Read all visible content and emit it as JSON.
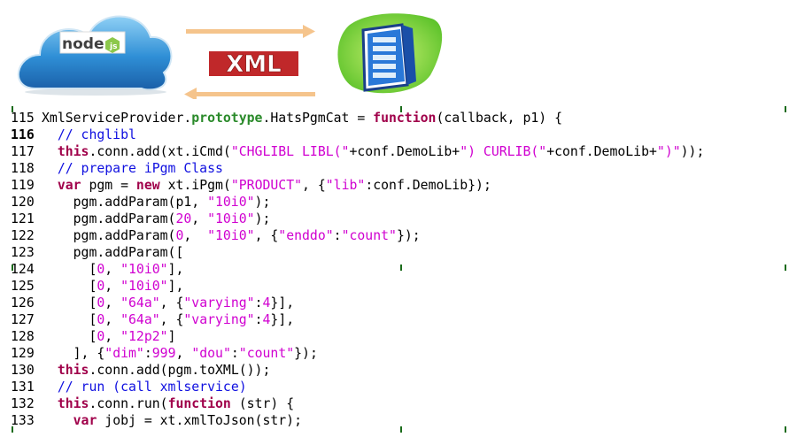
{
  "diagram": {
    "node_logo_text": "node",
    "xml_label": "XML"
  },
  "colors": {
    "keyword": "#a0004a",
    "property": "#2a8a2a",
    "string": "#d000d0",
    "comment": "#1010e0",
    "cloud": "#3a9ad8",
    "server_bg": "#7ad23a",
    "arrow": "#f5c48c",
    "xml_box": "#c0282a"
  },
  "code": {
    "lines": [
      {
        "num": "115",
        "bold": false,
        "tokens": [
          [
            "plain",
            "XmlServiceProvider."
          ],
          [
            "prop",
            "prototype"
          ],
          [
            "plain",
            ".HatsPgmCat = "
          ],
          [
            "kw",
            "function"
          ],
          [
            "plain",
            "(callback, p1) {"
          ]
        ]
      },
      {
        "num": "116",
        "bold": true,
        "tokens": [
          [
            "plain",
            "  "
          ],
          [
            "com",
            "// chglibl"
          ]
        ]
      },
      {
        "num": "117",
        "bold": false,
        "tokens": [
          [
            "plain",
            "  "
          ],
          [
            "kw",
            "this"
          ],
          [
            "plain",
            ".conn.add(xt.iCmd("
          ],
          [
            "str",
            "\"CHGLIBL LIBL(\""
          ],
          [
            "plain",
            "+conf.DemoLib+"
          ],
          [
            "str",
            "\") CURLIB(\""
          ],
          [
            "plain",
            "+conf.DemoLib+"
          ],
          [
            "str",
            "\")\""
          ],
          [
            "plain",
            "));"
          ]
        ]
      },
      {
        "num": "118",
        "bold": false,
        "tokens": [
          [
            "plain",
            "  "
          ],
          [
            "com",
            "// prepare iPgm Class"
          ]
        ]
      },
      {
        "num": "119",
        "bold": false,
        "tokens": [
          [
            "plain",
            "  "
          ],
          [
            "kw",
            "var"
          ],
          [
            "plain",
            " pgm = "
          ],
          [
            "kw",
            "new"
          ],
          [
            "plain",
            " xt.iPgm("
          ],
          [
            "str",
            "\"PRODUCT\""
          ],
          [
            "plain",
            ", {"
          ],
          [
            "str",
            "\"lib\""
          ],
          [
            "plain",
            ":conf.DemoLib});"
          ]
        ]
      },
      {
        "num": "120",
        "bold": false,
        "tokens": [
          [
            "plain",
            "    pgm.addParam(p1, "
          ],
          [
            "str",
            "\"10i0\""
          ],
          [
            "plain",
            ");"
          ]
        ]
      },
      {
        "num": "121",
        "bold": false,
        "tokens": [
          [
            "plain",
            "    pgm.addParam("
          ],
          [
            "num",
            "20"
          ],
          [
            "plain",
            ", "
          ],
          [
            "str",
            "\"10i0\""
          ],
          [
            "plain",
            ");"
          ]
        ]
      },
      {
        "num": "122",
        "bold": false,
        "tokens": [
          [
            "plain",
            "    pgm.addParam("
          ],
          [
            "num",
            "0"
          ],
          [
            "plain",
            ",  "
          ],
          [
            "str",
            "\"10i0\""
          ],
          [
            "plain",
            ", {"
          ],
          [
            "str",
            "\"enddo\""
          ],
          [
            "plain",
            ":"
          ],
          [
            "str",
            "\"count\""
          ],
          [
            "plain",
            "});"
          ]
        ]
      },
      {
        "num": "123",
        "bold": false,
        "tokens": [
          [
            "plain",
            "    pgm.addParam(["
          ]
        ]
      },
      {
        "num": "124",
        "bold": false,
        "tokens": [
          [
            "plain",
            "      ["
          ],
          [
            "num",
            "0"
          ],
          [
            "plain",
            ", "
          ],
          [
            "str",
            "\"10i0\""
          ],
          [
            "plain",
            "],"
          ]
        ]
      },
      {
        "num": "125",
        "bold": false,
        "tokens": [
          [
            "plain",
            "      ["
          ],
          [
            "num",
            "0"
          ],
          [
            "plain",
            ", "
          ],
          [
            "str",
            "\"10i0\""
          ],
          [
            "plain",
            "],"
          ]
        ]
      },
      {
        "num": "126",
        "bold": false,
        "tokens": [
          [
            "plain",
            "      ["
          ],
          [
            "num",
            "0"
          ],
          [
            "plain",
            ", "
          ],
          [
            "str",
            "\"64a\""
          ],
          [
            "plain",
            ", {"
          ],
          [
            "str",
            "\"varying\""
          ],
          [
            "plain",
            ":"
          ],
          [
            "num",
            "4"
          ],
          [
            "plain",
            "}],"
          ]
        ]
      },
      {
        "num": "127",
        "bold": false,
        "tokens": [
          [
            "plain",
            "      ["
          ],
          [
            "num",
            "0"
          ],
          [
            "plain",
            ", "
          ],
          [
            "str",
            "\"64a\""
          ],
          [
            "plain",
            ", {"
          ],
          [
            "str",
            "\"varying\""
          ],
          [
            "plain",
            ":"
          ],
          [
            "num",
            "4"
          ],
          [
            "plain",
            "}],"
          ]
        ]
      },
      {
        "num": "128",
        "bold": false,
        "tokens": [
          [
            "plain",
            "      ["
          ],
          [
            "num",
            "0"
          ],
          [
            "plain",
            ", "
          ],
          [
            "str",
            "\"12p2\""
          ],
          [
            "plain",
            "]"
          ]
        ]
      },
      {
        "num": "129",
        "bold": false,
        "tokens": [
          [
            "plain",
            "    ], {"
          ],
          [
            "str",
            "\"dim\""
          ],
          [
            "plain",
            ":"
          ],
          [
            "num",
            "999"
          ],
          [
            "plain",
            ", "
          ],
          [
            "str",
            "\"dou\""
          ],
          [
            "plain",
            ":"
          ],
          [
            "str",
            "\"count\""
          ],
          [
            "plain",
            "});"
          ]
        ]
      },
      {
        "num": "130",
        "bold": false,
        "tokens": [
          [
            "plain",
            "  "
          ],
          [
            "kw",
            "this"
          ],
          [
            "plain",
            ".conn.add(pgm.toXML());"
          ]
        ]
      },
      {
        "num": "131",
        "bold": false,
        "tokens": [
          [
            "plain",
            "  "
          ],
          [
            "com",
            "// run (call xmlservice)"
          ]
        ]
      },
      {
        "num": "132",
        "bold": false,
        "tokens": [
          [
            "plain",
            "  "
          ],
          [
            "kw",
            "this"
          ],
          [
            "plain",
            ".conn.run("
          ],
          [
            "kw",
            "function"
          ],
          [
            "plain",
            " (str) {"
          ]
        ]
      },
      {
        "num": "133",
        "bold": false,
        "tokens": [
          [
            "plain",
            "    "
          ],
          [
            "kw",
            "var"
          ],
          [
            "plain",
            " jobj = xt.xmlToJson(str);"
          ]
        ]
      }
    ]
  }
}
